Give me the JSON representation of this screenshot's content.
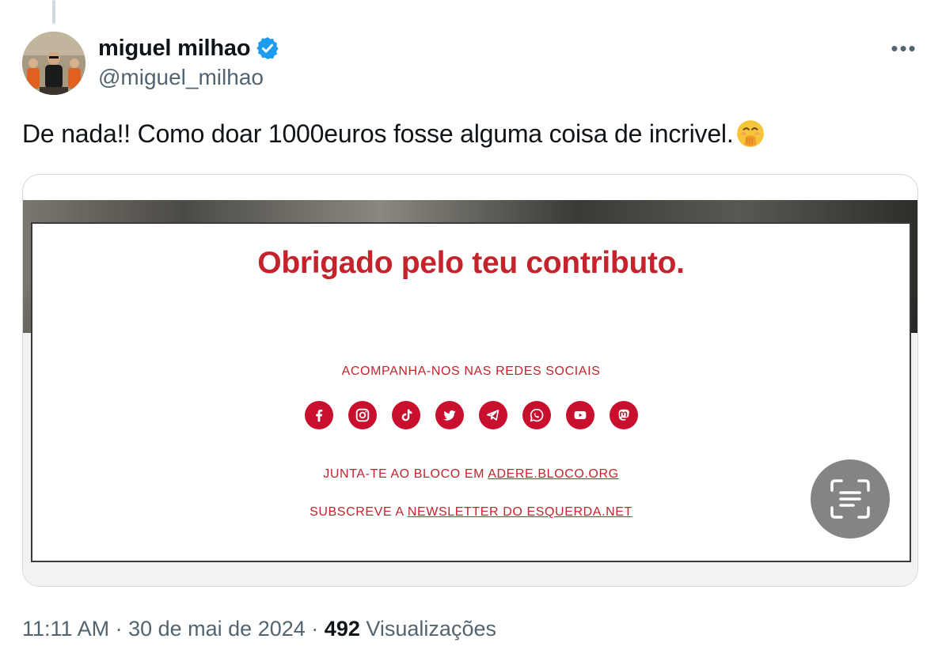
{
  "author": {
    "display_name": "miguel milhao",
    "handle": "@miguel_milhao",
    "verified": true
  },
  "tweet": {
    "text": "De nada!! Como doar 1000euros fosse alguma coisa de incrivel.",
    "emoji": "face-with-hand-over-mouth"
  },
  "media_card": {
    "title": "Obrigado pelo teu contributo.",
    "social_caption": "ACOMPANHA-NOS NAS REDES SOCIAIS",
    "social_icons": [
      "facebook-icon",
      "instagram-icon",
      "tiktok-icon",
      "twitter-icon",
      "telegram-icon",
      "whatsapp-icon",
      "youtube-icon",
      "mastodon-icon"
    ],
    "join_prefix": "JUNTA-TE AO BLOCO EM",
    "join_link": "ADERE.BLOCO.ORG",
    "newsletter_prefix": "SUBSCREVE A",
    "newsletter_link": "NEWSLETTER DO ESQUERDA.NET",
    "accent_color": "#c4232b"
  },
  "meta": {
    "time": "11:11 AM",
    "date": "30 de mai de 2024",
    "views_count": "492",
    "views_label": "Visualizações"
  },
  "colors": {
    "text": "#0f1419",
    "secondary": "#536471",
    "verified_blue": "#1d9bf0"
  }
}
